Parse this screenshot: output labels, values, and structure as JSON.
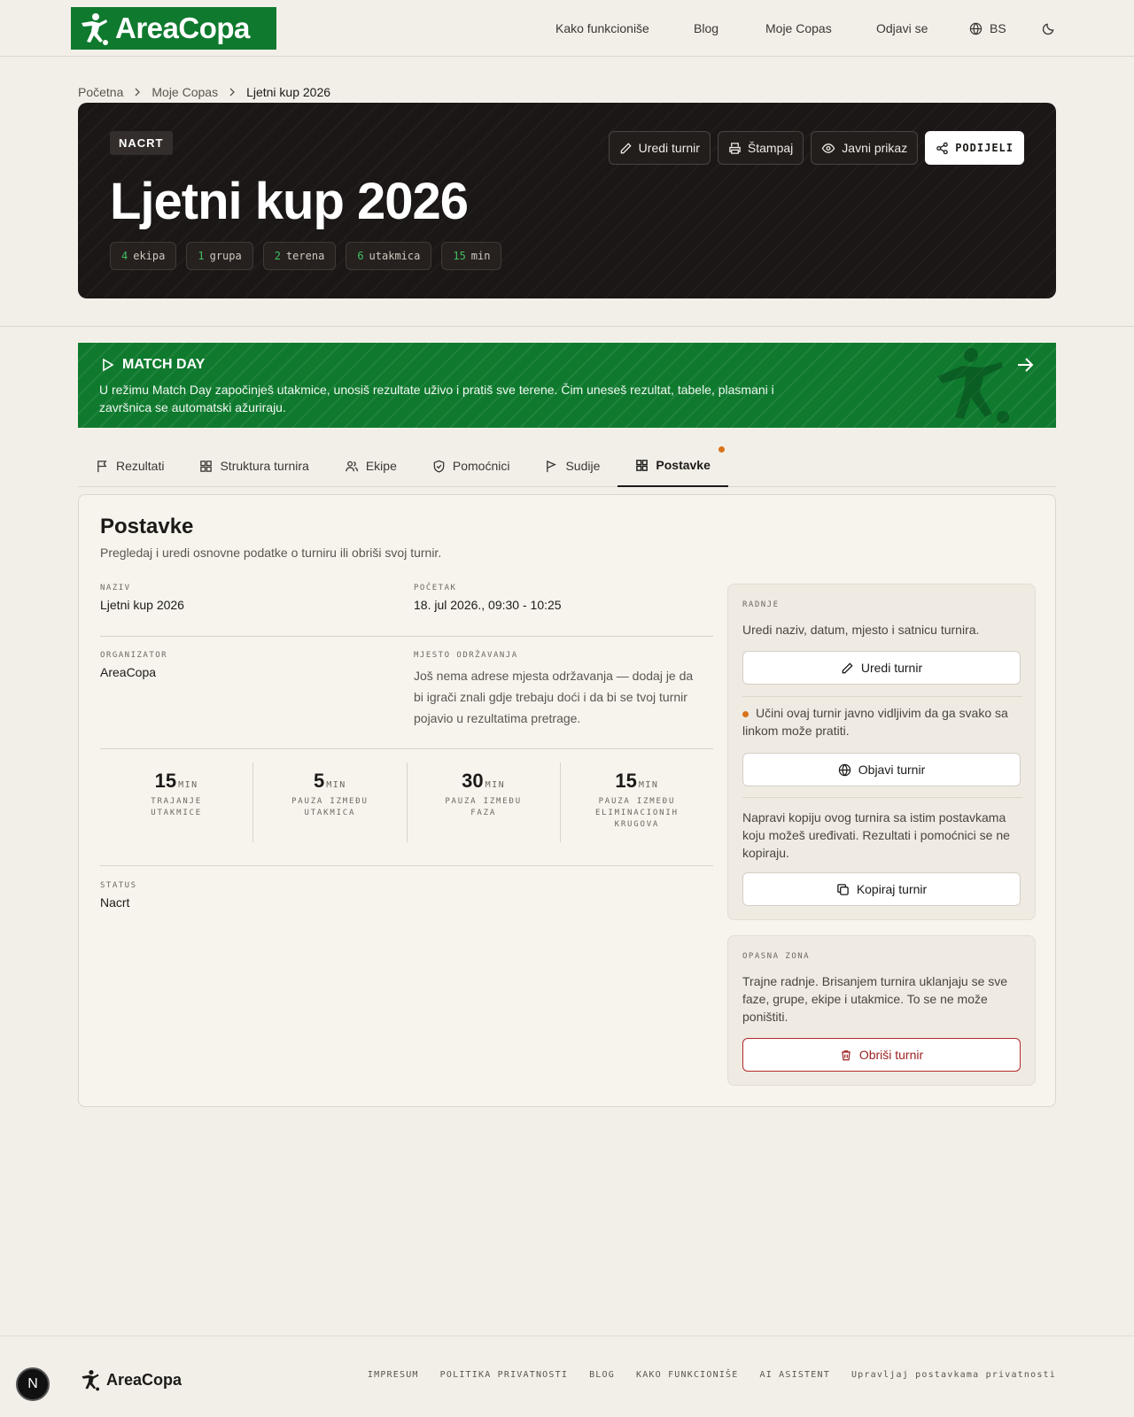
{
  "app": {
    "logo_text": "AreaCopa"
  },
  "nav": {
    "how_it_works": "Kako funkcioniše",
    "blog": "Blog",
    "my_copas": "Moje Copas",
    "logout": "Odjavi se",
    "language": "BS"
  },
  "breadcrumb": {
    "home": "Početna",
    "my_copas": "Moje Copas",
    "current": "Ljetni kup 2026"
  },
  "hero": {
    "status_badge": "NACRT",
    "title": "Ljetni kup 2026",
    "chips": [
      {
        "num": "4",
        "label": "ekipa"
      },
      {
        "num": "1",
        "label": "grupa"
      },
      {
        "num": "2",
        "label": "terena"
      },
      {
        "num": "6",
        "label": "utakmica"
      },
      {
        "num": "15",
        "label": "min"
      }
    ],
    "actions": {
      "edit": "Uredi turnir",
      "print": "Štampaj",
      "public_view": "Javni prikaz",
      "share": "PODIJELI"
    }
  },
  "matchday": {
    "title": "MATCH DAY",
    "description": "U režimu Match Day započinješ utakmice, unosiš rezultate uživo i pratiš sve terene. Čim uneseš rezultat, tabele, plasmani i završnica se automatski ažuriraju."
  },
  "tabs": [
    "Rezultati",
    "Struktura turnira",
    "Ekipe",
    "Pomoćnici",
    "Sudije",
    "Postavke"
  ],
  "settings": {
    "title": "Postavke",
    "subtitle": "Pregledaj i uredi osnovne podatke o turniru ili obriši svoj turnir.",
    "name_label": "NAZIV",
    "name_value": "Ljetni kup 2026",
    "start_label": "POČETAK",
    "start_value": "18. jul 2026., 09:30 - 10:25",
    "organizer_label": "ORGANIZATOR",
    "organizer_value": "AreaCopa",
    "venue_label": "MJESTO ODRŽAVANJA",
    "venue_value": "Još nema adrese mjesta održavanja — dodaj je da bi igrači znali gdje trebaju doći i da bi se tvoj turnir pojavio u rezultatima pretrage.",
    "stats": [
      {
        "num": "15",
        "unit": "MIN",
        "label": "TRAJANJE UTAKMICE"
      },
      {
        "num": "5",
        "unit": "MIN",
        "label": "PAUZA IZMEĐU UTAKMICA"
      },
      {
        "num": "30",
        "unit": "MIN",
        "label": "PAUZA IZMEĐU FAZA"
      },
      {
        "num": "15",
        "unit": "MIN",
        "label": "PAUZA IZMEĐU ELIMINACIONIH KRUGOVA"
      }
    ],
    "status_label": "STATUS",
    "status_value": "Nacrt"
  },
  "actions_card": {
    "label": "RADNJE",
    "edit_text": "Uredi naziv, datum, mjesto i satnicu turnira.",
    "edit_button": "Uredi turnir",
    "publish_text": "Učini ovaj turnir javno vidljivim da ga svako sa linkom može pratiti.",
    "publish_button": "Objavi turnir",
    "copy_text": "Napravi kopiju ovog turnira sa istim postavkama koju možeš uređivati. Rezultati i pomoćnici se ne kopiraju.",
    "copy_button": "Kopiraj turnir"
  },
  "danger_card": {
    "label": "OPASNA ZONA",
    "text": "Trajne radnje. Brisanjem turnira uklanjaju se sve faze, grupe, ekipe i utakmice. To se ne može poništiti.",
    "delete_button": "Obriši turnir"
  },
  "footer": {
    "logo_text": "AreaCopa",
    "links": [
      "IMPRESUM",
      "POLITIKA PRIVATNOSTI",
      "BLOG",
      "KAKO FUNKCIONIŠE",
      "AI ASISTENT",
      "Upravljaj postavkama privatnosti"
    ]
  },
  "dev_badge": "N",
  "colors": {
    "brand_green": "#0f7a2e",
    "hero_bg": "#1b1716",
    "danger": "#b32a2a",
    "notify_orange": "#d9731a"
  }
}
